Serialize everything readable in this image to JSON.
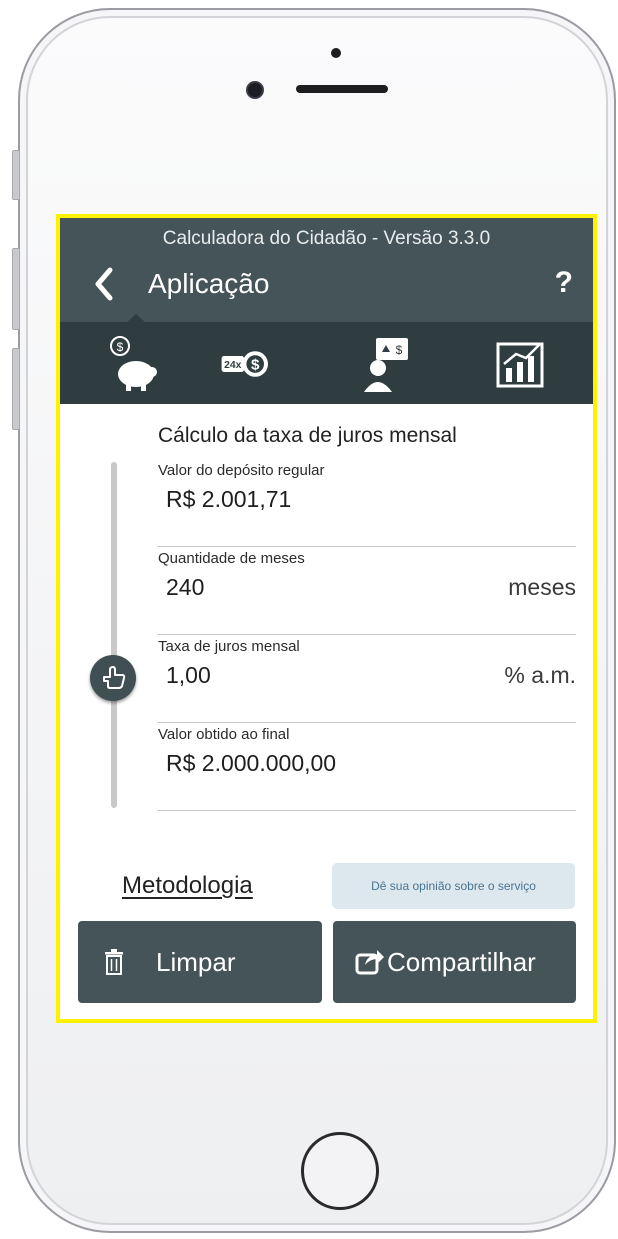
{
  "app": {
    "version_bar": "Calculadora do Cidadão - Versão 3.3.0",
    "title": "Aplicação",
    "help_label": "?"
  },
  "tabs": [
    {
      "icon": "piggy-bank-icon",
      "selected": true
    },
    {
      "icon": "installments-24x-icon",
      "selected": false
    },
    {
      "icon": "person-finance-icon",
      "selected": false
    },
    {
      "icon": "bar-chart-icon",
      "selected": false
    }
  ],
  "form": {
    "heading": "Cálculo da taxa de juros mensal",
    "fields": [
      {
        "label": "Valor do depósito regular",
        "value": "R$ 2.001,71",
        "unit": ""
      },
      {
        "label": "Quantidade de meses",
        "value": "240",
        "unit": "meses"
      },
      {
        "label": "Taxa de juros mensal",
        "value": "1,00",
        "unit": "% a.m."
      },
      {
        "label": "Valor obtido ao final",
        "value": "R$ 2.000.000,00",
        "unit": ""
      }
    ]
  },
  "footer": {
    "methodology_link": "Metodologia",
    "feedback_button": "Dê sua opinião sobre o serviço",
    "clear_button": "Limpar",
    "share_button": "Compartilhar"
  },
  "colors": {
    "header": "#455458",
    "tabbar": "#2f3d41",
    "highlight_border": "#fff200",
    "feedback_bg": "#dde7ee"
  }
}
